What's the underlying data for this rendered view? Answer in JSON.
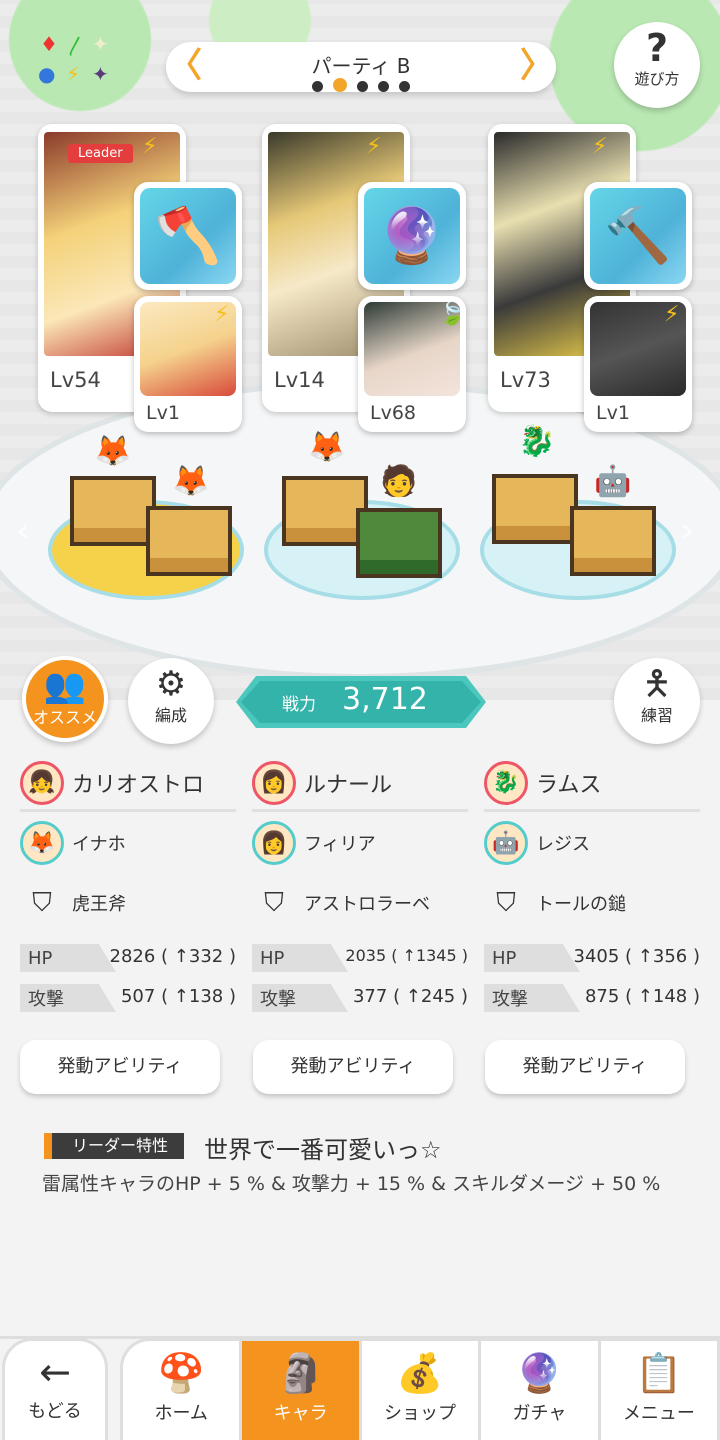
{
  "party": {
    "name": "パーティ B",
    "dots": 5,
    "active_dot": 1
  },
  "help": {
    "icon": "?",
    "label": "遊び方"
  },
  "elements_icon": "element-cycle-icon",
  "teams": [
    {
      "leader_badge": "Leader",
      "main_level": "Lv54",
      "sub_level": "Lv1",
      "main_element": "⚡",
      "sub_element": "⚡"
    },
    {
      "leader_badge": "",
      "main_level": "Lv14",
      "sub_level": "Lv68",
      "main_element": "⚡",
      "sub_element": "🍃"
    },
    {
      "leader_badge": "",
      "main_level": "Lv73",
      "sub_level": "Lv1",
      "main_element": "⚡",
      "sub_element": "⚡"
    }
  ],
  "buttons": {
    "recommend": "オススメ",
    "formation": "編成",
    "practice": "練習"
  },
  "power": {
    "label": "戦力",
    "value": "3,712"
  },
  "columns": [
    {
      "main": "カリオストロ",
      "sub": "イナホ",
      "weapon": "虎王斧",
      "hp": "2826 ( ↑332 )",
      "atk": "507 ( ↑138 )",
      "ability": "発動アビリティ"
    },
    {
      "main": "ルナール",
      "sub": "フィリア",
      "weapon": "アストロラーベ",
      "hp": "2035 ( ↑1345 )",
      "atk": "377 ( ↑245 )",
      "ability": "発動アビリティ"
    },
    {
      "main": "ラムス",
      "sub": "レジス",
      "weapon": "トールの鎚",
      "hp": "3405 ( ↑356 )",
      "atk": "875 ( ↑148 )",
      "ability": "発動アビリティ"
    }
  ],
  "stat_labels": {
    "hp": "HP",
    "atk": "攻撃"
  },
  "leader_skill": {
    "tag": "リーダー特性",
    "title": "世界で一番可愛いっ☆",
    "description": "雷属性キャラのHP + 5 % & 攻撃力 + 15 % & スキルダメージ + 50 %"
  },
  "nav": {
    "back": "もどる",
    "tabs": [
      "ホーム",
      "キャラ",
      "ショップ",
      "ガチャ",
      "メニュー"
    ],
    "active": "キャラ"
  }
}
